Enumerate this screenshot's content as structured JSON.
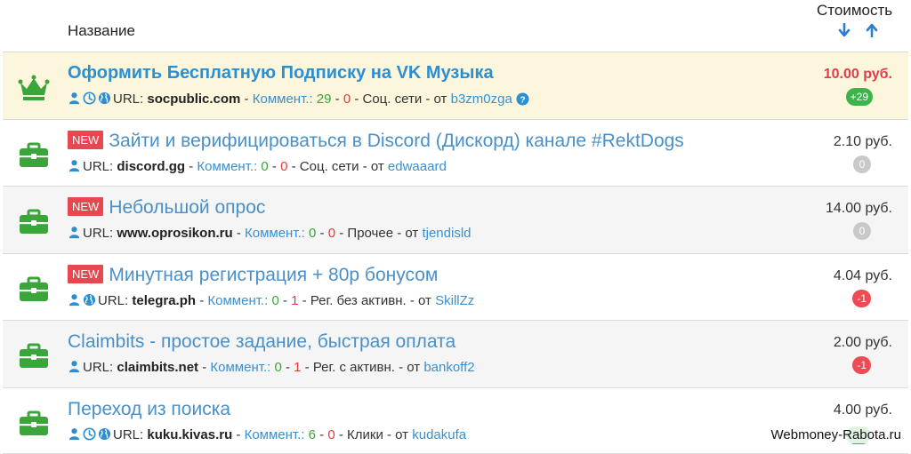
{
  "header": {
    "name_label": "Название",
    "cost_label": "Стоимость"
  },
  "tasks": [
    {
      "title": "Оформить Бесплатную Подписку на VK Музыка",
      "new": "",
      "icons": [
        "user-icon",
        "clock-icon",
        "globe-icon"
      ],
      "url_label": "URL:",
      "url": "socpublic.com",
      "comments_label": "Коммент.:",
      "comments_pos": "29",
      "comments_neg": "0",
      "category": "Соц. сети",
      "from_label": "от",
      "author": "b3zm0zga",
      "price": "10.00 руб.",
      "score": "+29",
      "score_type": "pos"
    },
    {
      "title": "Зайти и верифицироваться в Discord (Дискорд) канале #RektDogs",
      "new": "NEW",
      "icons": [
        "user-icon"
      ],
      "url_label": "URL:",
      "url": "discord.gg",
      "comments_label": "Коммент.:",
      "comments_pos": "0",
      "comments_neg": "0",
      "category": "Соц. сети",
      "from_label": "от",
      "author": "edwaaard",
      "price": "2.10 руб.",
      "score": "0",
      "score_type": "zero"
    },
    {
      "title": "Небольшой опрос",
      "new": "NEW",
      "icons": [
        "user-icon"
      ],
      "url_label": "URL:",
      "url": "www.oprosikon.ru",
      "comments_label": "Коммент.:",
      "comments_pos": "0",
      "comments_neg": "0",
      "category": "Прочее",
      "from_label": "от",
      "author": "tjendisld",
      "price": "14.00 руб.",
      "score": "0",
      "score_type": "zero"
    },
    {
      "title": "Минутная регистрация + 80р бонусом",
      "new": "NEW",
      "icons": [
        "user-icon",
        "globe-icon"
      ],
      "url_label": "URL:",
      "url": "telegra.ph",
      "comments_label": "Коммент.:",
      "comments_pos": "0",
      "comments_neg": "1",
      "category": "Рег. без активн.",
      "from_label": "от",
      "author": "SkillZz",
      "price": "4.04 руб.",
      "score": "-1",
      "score_type": "neg"
    },
    {
      "title": "Claimbits - простое задание, быстрая оплата",
      "new": "",
      "icons": [
        "user-icon"
      ],
      "url_label": "URL:",
      "url": "claimbits.net",
      "comments_label": "Коммент.:",
      "comments_pos": "0",
      "comments_neg": "1",
      "category": "Рег. с активн.",
      "from_label": "от",
      "author": "bankoff2",
      "price": "2.00 руб.",
      "score": "-1",
      "score_type": "neg"
    },
    {
      "title": "Переход из поиска",
      "new": "",
      "icons": [
        "user-icon",
        "clock-icon",
        "globe-icon"
      ],
      "url_label": "URL:",
      "url": "kuku.kivas.ru",
      "comments_label": "Коммент.:",
      "comments_pos": "6",
      "comments_neg": "0",
      "category": "Клики",
      "from_label": "от",
      "author": "kudakufa",
      "price": "4.00 руб.",
      "score": "",
      "score_type": "pos"
    }
  ],
  "watermark": "Webmoney-Rabota.ru",
  "colors": {
    "title_blue": "#4a90c8",
    "vip_bg": "#fcf6dc",
    "price_red": "#e23b4b",
    "new_red": "#e8474f",
    "icon_green": "#3aa53a",
    "score_pos": "#3bb44a",
    "score_zero": "#c9c9c9",
    "score_neg": "#ee4b55"
  }
}
